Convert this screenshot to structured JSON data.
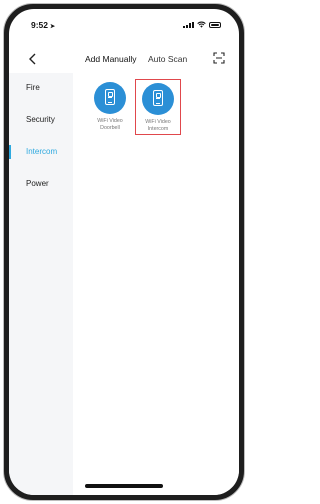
{
  "status": {
    "time": "9:52",
    "location_glyph": "➤"
  },
  "nav": {
    "back_icon": "chevron-left-icon",
    "tabs": [
      {
        "label": "Add Manually",
        "selected": true
      },
      {
        "label": "Auto Scan",
        "selected": false
      }
    ],
    "scan_icon": "scan-frame-icon"
  },
  "sidebar": {
    "items": [
      {
        "label": "Fire",
        "active": false
      },
      {
        "label": "Security",
        "active": false
      },
      {
        "label": "Intercom",
        "active": true
      },
      {
        "label": "Power",
        "active": false
      }
    ],
    "active_color": "#2ea9df"
  },
  "devices": [
    {
      "line1": "WiFi Video",
      "line2": "Doorbell",
      "selected": false,
      "icon": "intercom-device-icon"
    },
    {
      "line1": "WiFi Video",
      "line2": "Intercom",
      "selected": true,
      "icon": "intercom-device-icon"
    }
  ],
  "colors": {
    "device_circle": "#2b8fd6",
    "selection_border": "#e0474c"
  }
}
